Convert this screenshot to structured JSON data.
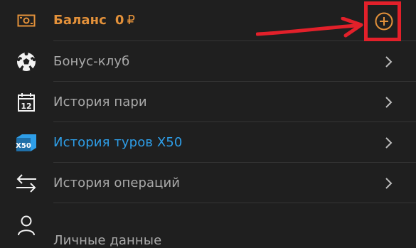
{
  "colors": {
    "background": "#1f1f1f",
    "accent_orange": "#e3913a",
    "link_blue": "#2e9ee8",
    "label_gray": "#a9a9a9",
    "annotation_red": "#e2202a"
  },
  "balance": {
    "label": "Баланс",
    "amount": "0",
    "currency": "₽",
    "icon": "wallet-icon",
    "action_icon": "add-circle-icon"
  },
  "menu": [
    {
      "label": "Бонус-клуб",
      "icon": "soccer-ball-icon"
    },
    {
      "label": "История пари",
      "icon": "calendar-icon",
      "icon_text": "12"
    },
    {
      "label": "История туров X50",
      "icon": "x50-ticket-icon",
      "icon_text": "X50"
    },
    {
      "label": "История операций",
      "icon": "transfer-arrows-icon"
    },
    {
      "label": "Личные данные",
      "icon": "person-icon"
    }
  ],
  "annotation": {
    "type": "arrow-and-box",
    "target": "add-circle-icon"
  }
}
